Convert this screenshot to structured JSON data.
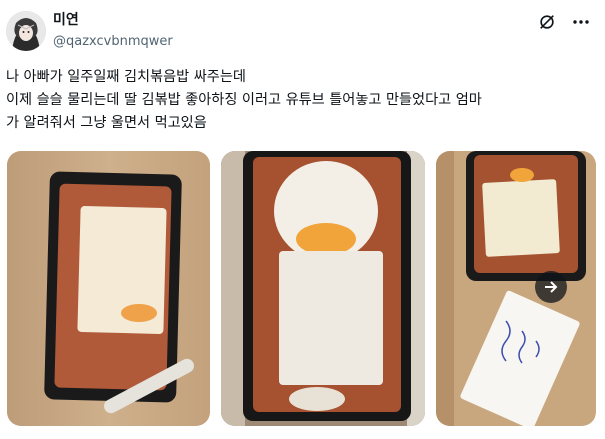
{
  "author": {
    "display_name": "미연",
    "handle": "@qazxcvbnmqwer"
  },
  "tweet": {
    "text": "나 아빠가 일주일째 김치볶음밥 싸주는데\n이제 슬슬 물리는데 딸 김볶밥 좋아하징 이러고 유튜브 틀어놓고 만들었다고 엄마\n가 알려줘서 그냥 울면서 먹고있음"
  },
  "media": {
    "count": 3,
    "items": [
      "food-photo-1",
      "food-photo-2",
      "food-photo-3"
    ]
  },
  "icons": {
    "top_left": "grok-icon",
    "top_right": "more-icon",
    "carousel": "arrow-right-icon"
  },
  "colors": {
    "text": "#0f1419",
    "secondary": "#536471"
  }
}
